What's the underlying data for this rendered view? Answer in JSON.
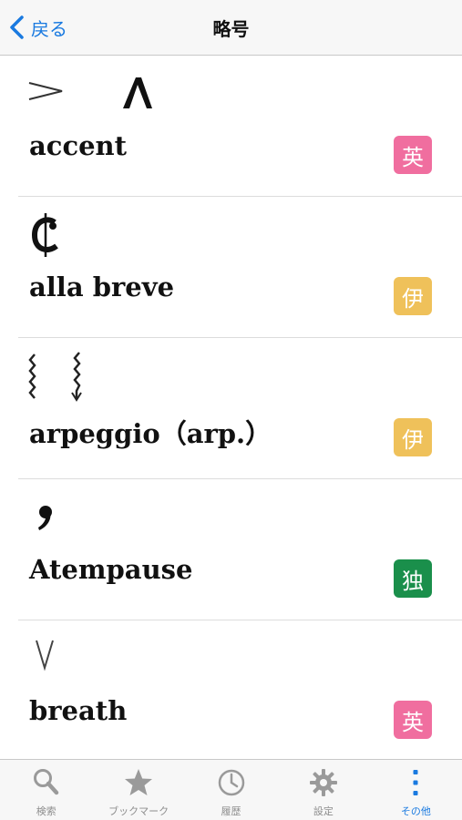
{
  "nav": {
    "back_label": "戻る",
    "title": "略号"
  },
  "entries": [
    {
      "term": "accent",
      "badge": "英",
      "badge_color": "#f06e9f",
      "symbol": "accent-icons"
    },
    {
      "term": "alla breve",
      "badge": "伊",
      "badge_color": "#efc15a",
      "symbol": "cut-time-icon"
    },
    {
      "term": "arpeggio（arp.）",
      "badge": "伊",
      "badge_color": "#efc15a",
      "symbol": "arpeggio-icons"
    },
    {
      "term": "Atempause",
      "badge": "独",
      "badge_color": "#1a8f4b",
      "symbol": "breath-comma-icon"
    },
    {
      "term": "breath",
      "badge": "英",
      "badge_color": "#f06e9f",
      "symbol": "breath-v-icon"
    }
  ],
  "tabs": [
    {
      "label": "検索",
      "icon": "search-icon",
      "active": false
    },
    {
      "label": "ブックマーク",
      "icon": "star-icon",
      "active": false
    },
    {
      "label": "履歴",
      "icon": "clock-icon",
      "active": false
    },
    {
      "label": "設定",
      "icon": "gear-icon",
      "active": false
    },
    {
      "label": "その他",
      "icon": "more-icon",
      "active": true
    }
  ],
  "colors": {
    "accent_blue": "#1a7ae0",
    "tab_inactive": "#8e8e8e"
  }
}
